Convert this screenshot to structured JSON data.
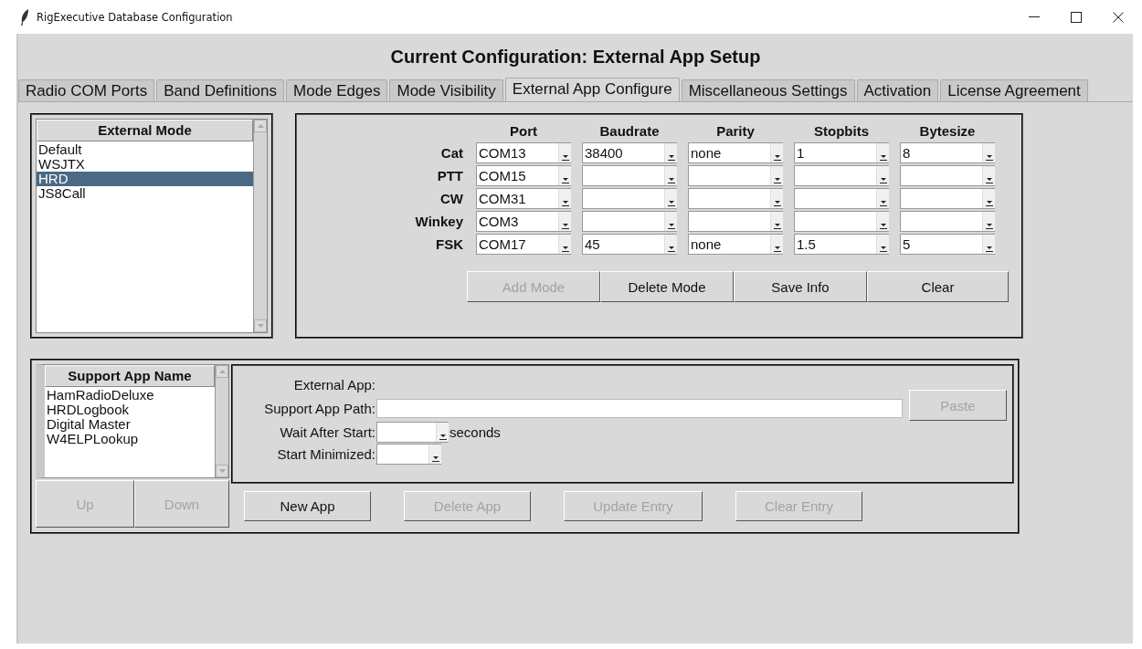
{
  "window": {
    "title": "RigExecutive Database Configuration"
  },
  "heading": "Current Configuration: External App Setup",
  "tabs": [
    {
      "label": "Radio COM Ports",
      "selected": false
    },
    {
      "label": "Band Definitions",
      "selected": false
    },
    {
      "label": "Mode Edges",
      "selected": false
    },
    {
      "label": "Mode Visibility",
      "selected": false
    },
    {
      "label": "External App Configure",
      "selected": true
    },
    {
      "label": "Miscellaneous Settings",
      "selected": false
    },
    {
      "label": "Activation",
      "selected": false
    },
    {
      "label": "License Agreement",
      "selected": false
    }
  ],
  "external_modes": {
    "header": "External Mode",
    "items": [
      {
        "label": "Default",
        "selected": false
      },
      {
        "label": "WSJTX",
        "selected": false
      },
      {
        "label": "HRD",
        "selected": true
      },
      {
        "label": "JS8Call",
        "selected": false
      }
    ]
  },
  "com_config": {
    "columns": [
      "Port",
      "Baudrate",
      "Parity",
      "Stopbits",
      "Bytesize"
    ],
    "rows": [
      {
        "label": "Cat",
        "port": "COM13",
        "baudrate": "38400",
        "parity": "none",
        "stopbits": "1",
        "bytesize": "8"
      },
      {
        "label": "PTT",
        "port": "COM15"
      },
      {
        "label": "CW",
        "port": "COM31"
      },
      {
        "label": "Winkey",
        "port": "COM3"
      },
      {
        "label": "FSK",
        "port": "COM17",
        "baudrate": "45",
        "parity": "none",
        "stopbits": "1.5",
        "bytesize": "5"
      }
    ]
  },
  "mode_buttons": [
    {
      "label": "Add Mode",
      "disabled": true
    },
    {
      "label": "Delete Mode",
      "disabled": false
    },
    {
      "label": "Save Info",
      "disabled": false
    },
    {
      "label": "Clear",
      "disabled": false
    }
  ],
  "support_apps": {
    "header": "Support App Name",
    "items": [
      {
        "label": "HamRadioDeluxe",
        "selected": false
      },
      {
        "label": "HRDLogbook",
        "selected": false
      },
      {
        "label": "Digital Master",
        "selected": false
      },
      {
        "label": "W4ELPLookup",
        "selected": false
      }
    ],
    "buttons": [
      {
        "label": "Up",
        "disabled": true
      },
      {
        "label": "Down",
        "disabled": true
      }
    ]
  },
  "app_form": {
    "external_app_label": "External App:",
    "path_label": "Support App Path:",
    "paste_button": {
      "label": "Paste",
      "disabled": true
    },
    "wait_label": "Wait After Start:",
    "wait_unit": "seconds",
    "minimized_label": "Start Minimized:"
  },
  "app_buttons": [
    {
      "label": "New App",
      "disabled": false
    },
    {
      "label": "Delete App",
      "disabled": true
    },
    {
      "label": "Update Entry",
      "disabled": true
    },
    {
      "label": "Clear Entry",
      "disabled": true
    }
  ]
}
